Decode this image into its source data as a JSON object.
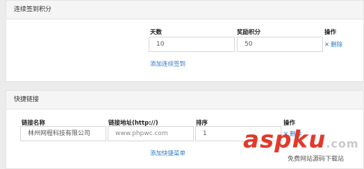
{
  "consecutive": {
    "title": "连续签到积分",
    "headers": {
      "days": "天数",
      "points": "奖励积分",
      "action": "操作"
    },
    "row": {
      "days": "10",
      "points": "50",
      "delete_label": "删除"
    },
    "add_label": "添加连续签到"
  },
  "quicklinks": {
    "title": "快捷链接",
    "headers": {
      "name": "链接名称",
      "url": "链接地址(http://)",
      "order": "排序",
      "action": "操作"
    },
    "row": {
      "name": "林州网程科技有限公司",
      "url": "www.phpwc.com",
      "order": "1",
      "delete_label": "删除"
    },
    "add_label": "添加快捷菜单"
  },
  "watermark": {
    "logo": "aspku",
    "tld": ".com",
    "sub": "免费网站源码下载站"
  },
  "colors": {
    "link": "#2f7bc6",
    "watermark": "#e13a2c"
  },
  "icons": {
    "delete": "close-icon"
  }
}
